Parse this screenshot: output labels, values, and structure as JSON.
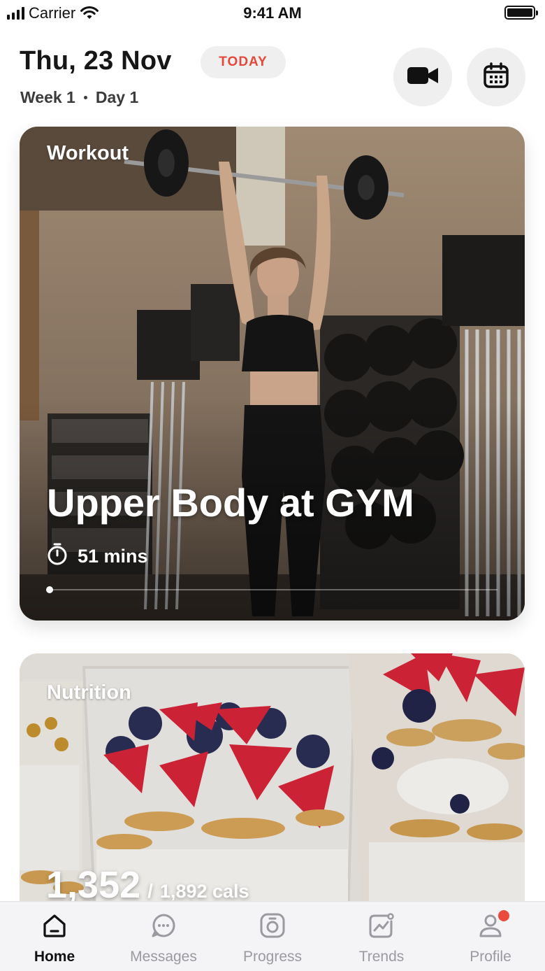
{
  "status_bar": {
    "carrier": "Carrier",
    "time": "9:41 AM"
  },
  "header": {
    "date": "Thu, 23 Nov",
    "today_badge": "TODAY",
    "week": "Week 1",
    "day": "Day 1",
    "accent_color": "#e4483b"
  },
  "workout_card": {
    "label": "Workout",
    "title": "Upper Body at GYM",
    "duration": "51 mins",
    "progress": 0
  },
  "nutrition_card": {
    "label": "Nutrition",
    "calories_consumed": "1,352",
    "separator": "/",
    "calories_target": "1,892 cals"
  },
  "tab_bar": {
    "items": [
      {
        "label": "Home",
        "icon": "home-icon",
        "active": true
      },
      {
        "label": "Messages",
        "icon": "chat-bubble-icon",
        "active": false
      },
      {
        "label": "Progress",
        "icon": "progress-icon",
        "active": false
      },
      {
        "label": "Trends",
        "icon": "trends-icon",
        "active": false
      },
      {
        "label": "Profile",
        "icon": "profile-icon",
        "active": false,
        "badge": true
      }
    ]
  }
}
